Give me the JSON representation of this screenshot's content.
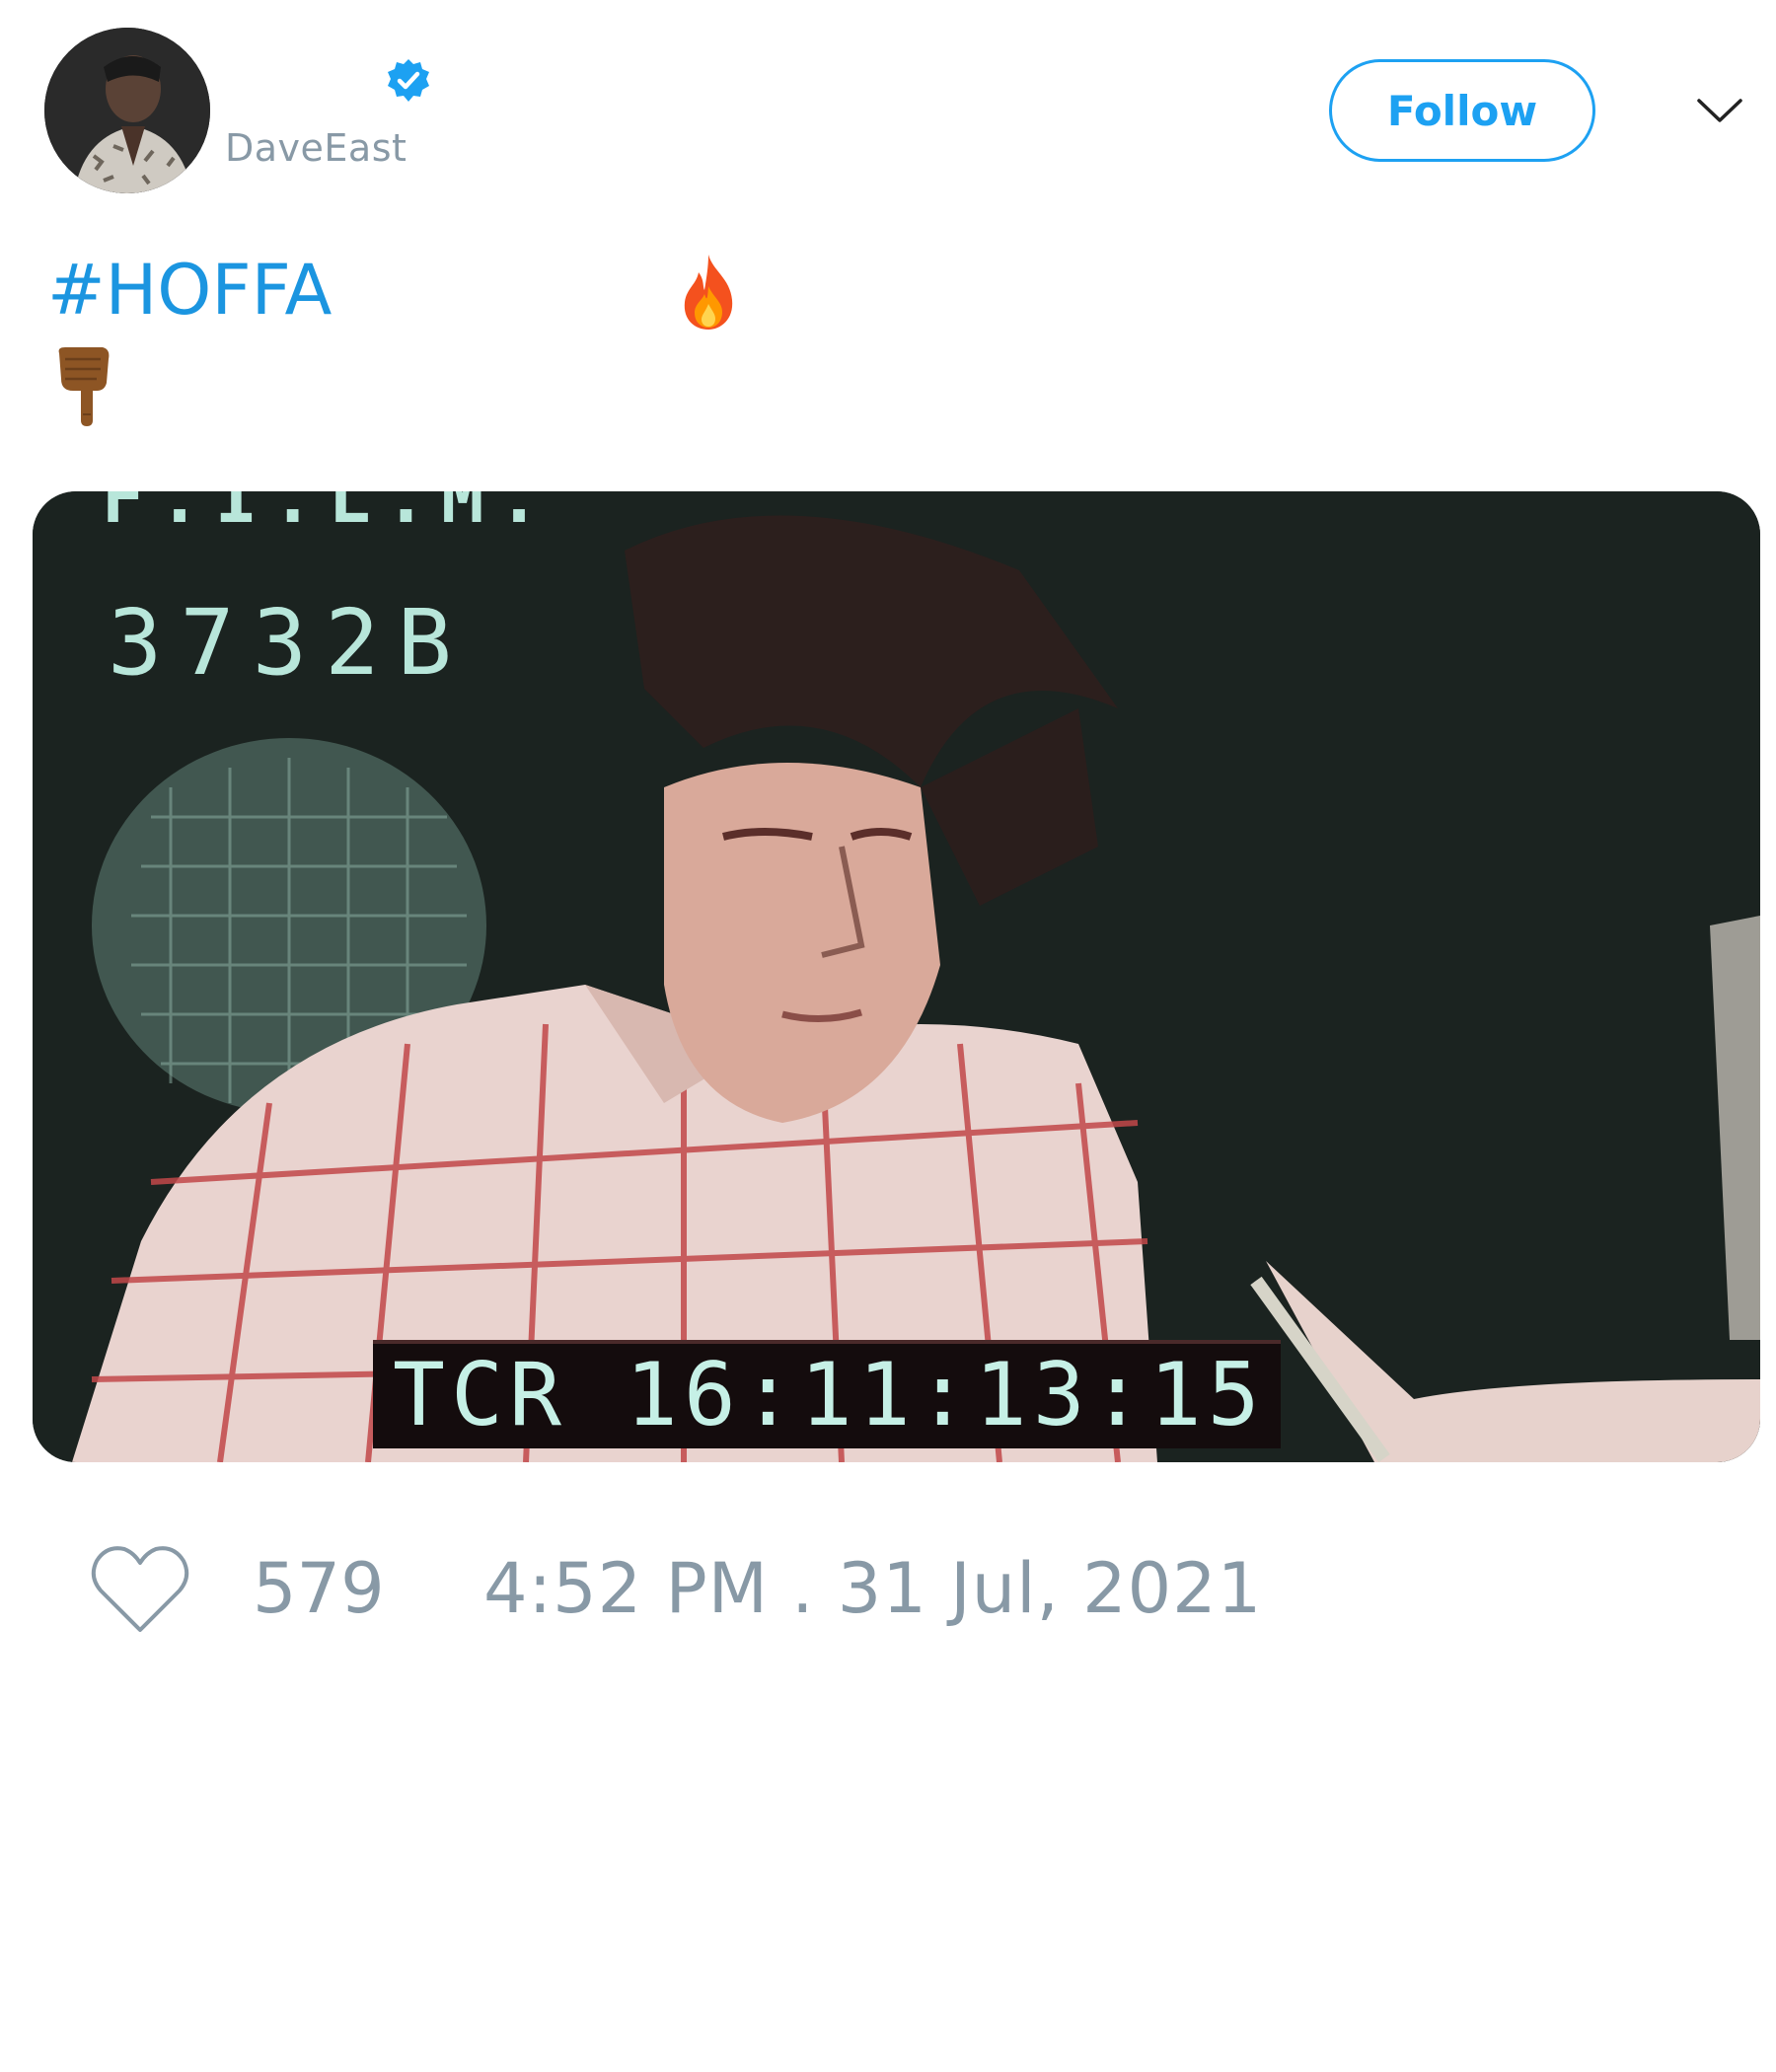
{
  "author": {
    "display_name": "",
    "handle": "DaveEast",
    "verified": true,
    "avatar_icon": "avatar-photo"
  },
  "header": {
    "follow_label": "Follow",
    "menu_icon": "chevron-down-icon"
  },
  "tweet": {
    "hashtag": "#HOFFA",
    "emojis": [
      "fire-emoji",
      "backhand-index-pointing-down-emoji"
    ]
  },
  "media": {
    "type": "video-frame",
    "overlay_top": "F.I.L.M.",
    "reel_id": "3732B",
    "timecode": "TCR 16:11:13:15"
  },
  "footer": {
    "likes": "579",
    "timestamp": "4:52 PM . 31 Jul, 2021"
  },
  "colors": {
    "accent": "#1da1f2",
    "hashtag": "#1b95e0",
    "muted": "#8899a6"
  }
}
